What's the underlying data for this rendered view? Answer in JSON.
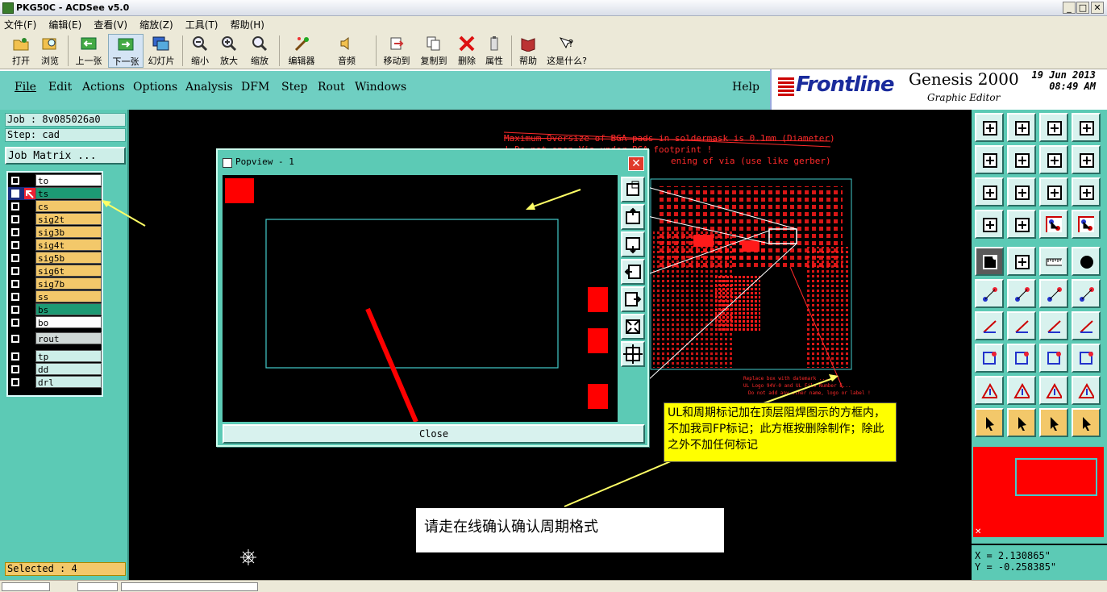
{
  "window": {
    "title": "PKG50C - ACDSee v5.0",
    "min": "_",
    "max": "□",
    "close": "✕"
  },
  "acd_menu": [
    "文件(F)",
    "编辑(E)",
    "查看(V)",
    "缩放(Z)",
    "工具(T)",
    "帮助(H)"
  ],
  "acd_toolbar": [
    {
      "label": "打开",
      "icon": "open-folder-icon"
    },
    {
      "label": "浏览",
      "icon": "browse-icon"
    },
    {
      "label": "上一张",
      "icon": "previous-icon"
    },
    {
      "label": "下一张",
      "icon": "next-icon"
    },
    {
      "label": "幻灯片",
      "icon": "slideshow-icon"
    },
    {
      "label": "缩小",
      "icon": "zoom-out-icon"
    },
    {
      "label": "放大",
      "icon": "zoom-in-icon"
    },
    {
      "label": "缩放",
      "icon": "zoom-icon"
    },
    {
      "label": "编辑器",
      "icon": "editor-icon"
    },
    {
      "label": "音频",
      "icon": "audio-icon"
    },
    {
      "label": "移动到",
      "icon": "move-to-icon"
    },
    {
      "label": "复制到",
      "icon": "copy-to-icon"
    },
    {
      "label": "删除",
      "icon": "delete-icon"
    },
    {
      "label": "属性",
      "icon": "properties-icon"
    },
    {
      "label": "帮助",
      "icon": "help-book-icon"
    },
    {
      "label": "这是什么?",
      "icon": "whats-this-icon"
    }
  ],
  "genesis_menu": [
    "File",
    "Edit",
    "Actions",
    "Options",
    "Analysis",
    "DFM",
    "Step",
    "Rout",
    "Windows"
  ],
  "genesis_help": "Help",
  "brand": {
    "logo": "Frontline",
    "product": "Genesis 2000",
    "subtitle": "Graphic Editor",
    "date": "19 Jun 2013",
    "time": "08:49 AM"
  },
  "job": {
    "job_label": "Job : 8v085026a0",
    "step_label": "Step: cad",
    "matrix_button": "Job Matrix ..."
  },
  "layers": [
    {
      "name": "to",
      "color": "#ffffff"
    },
    {
      "name": "ts",
      "color": "#1d9a74"
    },
    {
      "name": "cs",
      "color": "#f3c86a"
    },
    {
      "name": "sig2t",
      "color": "#f3c86a"
    },
    {
      "name": "sig3b",
      "color": "#f3c86a"
    },
    {
      "name": "sig4t",
      "color": "#f3c86a"
    },
    {
      "name": "sig5b",
      "color": "#f3c86a"
    },
    {
      "name": "sig6t",
      "color": "#f3c86a"
    },
    {
      "name": "sig7b",
      "color": "#f3c86a"
    },
    {
      "name": "ss",
      "color": "#f3c86a"
    },
    {
      "name": "bs",
      "color": "#1d9a74"
    },
    {
      "name": "bo",
      "color": "#ffffff"
    },
    {
      "name": "rout",
      "color": "#cfd8d6"
    },
    {
      "name": "tp",
      "color": "#cdeee8"
    },
    {
      "name": "dd",
      "color": "#cdeee8"
    },
    {
      "name": "drl",
      "color": "#cdeee8"
    }
  ],
  "selected_count": "Selected : 4",
  "popview": {
    "title": "Popview - 1",
    "close_label": "Close"
  },
  "board_notes": [
    "Maximum Oversize of BGA pads in soldermask is 0.1mm (Diameter)",
    "! Do not open Via under BGA footprint !",
    "ening of via (use like gerber)"
  ],
  "board_small_notes": [
    "Replace box with datemark ...",
    "UL Logo 94V-0 and UL File Number E...",
    "Do not add any other name, logo or label !"
  ],
  "annotation_yellow": "UL和周期标记加在顶层阻焊图示的方框内，不加我司FP标记；此方框按删除制作；除此之外不加任何标记",
  "annotation_white": "请走在线确认确认周期格式",
  "coords": {
    "x": "X = 2.130865\"",
    "y": "Y = -0.258385\""
  },
  "colors": {
    "panel": "#5ccab5",
    "canvas": "#000000",
    "copper": "#ff0000",
    "accent_yellow": "#f3c86a"
  }
}
